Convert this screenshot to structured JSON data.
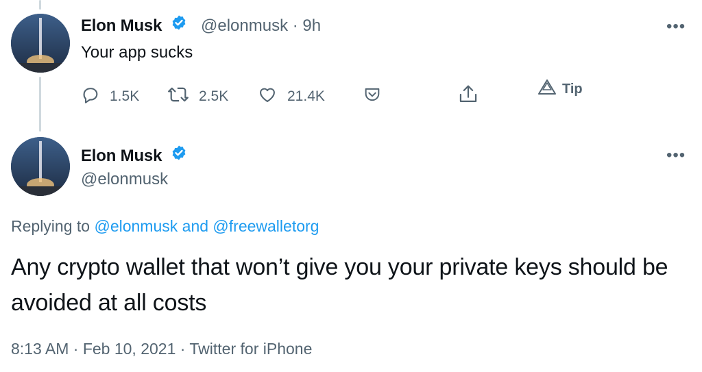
{
  "first_tweet": {
    "author_name": "Elon Musk",
    "author_handle": "@elonmusk",
    "separator": "·",
    "time_ago": "9h",
    "text": "Your app sucks",
    "more_label": "•••",
    "actions": {
      "reply_count": "1.5K",
      "retweet_count": "2.5K",
      "like_count": "21.4K",
      "tip_label": "Tip"
    }
  },
  "main_tweet": {
    "author_name": "Elon Musk",
    "author_handle": "@elonmusk",
    "more_label": "•••",
    "replying_prefix": "Replying to",
    "replying_user1": "@elonmusk",
    "replying_and": "and",
    "replying_user2": "@freewalletorg",
    "text": "Any crypto wallet that won’t give you your private keys should be avoided at all costs",
    "timestamp": "8:13 AM · Feb 10, 2021 · Twitter for iPhone"
  },
  "colors": {
    "accent": "#1d9bf0",
    "secondary_text": "#536471",
    "primary_text": "#0f1419",
    "thread_line": "#cfd9de"
  },
  "icons": [
    "reply-icon",
    "retweet-icon",
    "like-icon",
    "share-icon",
    "tip-icon",
    "verified-badge-icon",
    "more-icon"
  ]
}
